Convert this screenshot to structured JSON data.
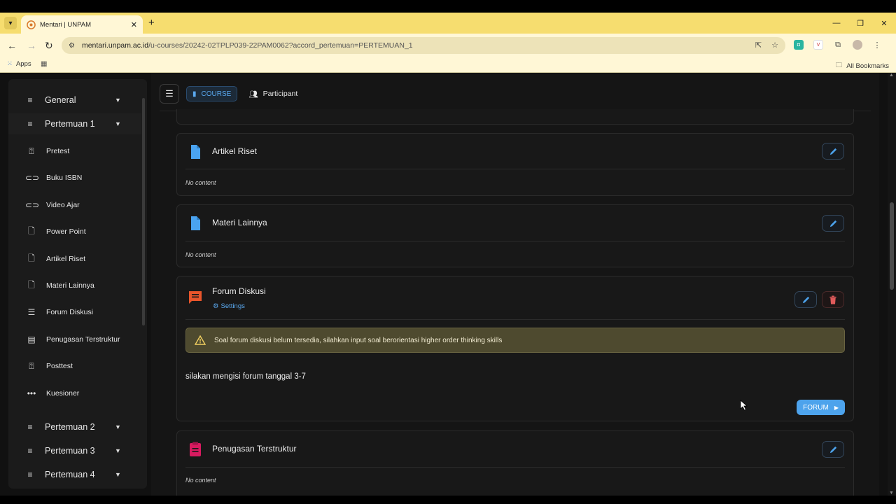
{
  "browser": {
    "tab_title": "Mentari | UNPAM",
    "url_domain": "mentari.unpam.ac.id",
    "url_path": "/u-courses/20242-02TPLP039-22PAM0062?accord_pertemuan=PERTEMUAN_1",
    "bookmarks_apps": "Apps",
    "bookmarks_all": "All Bookmarks"
  },
  "sidebar": {
    "sections": [
      {
        "label": "General"
      },
      {
        "label": "Pertemuan 1"
      },
      {
        "label": "Pertemuan 2"
      },
      {
        "label": "Pertemuan 3"
      },
      {
        "label": "Pertemuan 4"
      }
    ],
    "items": [
      {
        "label": "Pretest",
        "icon": "quiz-icon"
      },
      {
        "label": "Buku ISBN",
        "icon": "link-icon"
      },
      {
        "label": "Video Ajar",
        "icon": "link-icon"
      },
      {
        "label": "Power Point",
        "icon": "document-icon"
      },
      {
        "label": "Artikel Riset",
        "icon": "document-icon"
      },
      {
        "label": "Materi Lainnya",
        "icon": "document-icon"
      },
      {
        "label": "Forum Diskusi",
        "icon": "forum-icon"
      },
      {
        "label": "Penugasan Terstruktur",
        "icon": "assignment-icon"
      },
      {
        "label": "Posttest",
        "icon": "quiz-icon"
      },
      {
        "label": "Kuesioner",
        "icon": "more-icon"
      }
    ]
  },
  "toolbar": {
    "course_tab": "COURSE",
    "participant_tab": "Participant"
  },
  "cards": {
    "artikel": {
      "title": "Artikel Riset",
      "note": "No content"
    },
    "materi": {
      "title": "Materi Lainnya",
      "note": "No content"
    },
    "forum": {
      "title": "Forum Diskusi",
      "settings": "Settings",
      "alert": "Soal forum diskusi belum tersedia, silahkan input soal berorientasi higher order thinking skills",
      "description": "silakan mengisi forum tanggal 3-7",
      "button": "FORUM"
    },
    "penugasan": {
      "title": "Penugasan Terstruktur",
      "note": "No content"
    }
  },
  "colors": {
    "accent_blue": "#4da3ec",
    "doc_icon_blue": "#4aa3f0",
    "forum_icon_orange": "#e8552b",
    "assignment_icon_pink": "#d81b60",
    "delete_red": "#e05a5a"
  }
}
